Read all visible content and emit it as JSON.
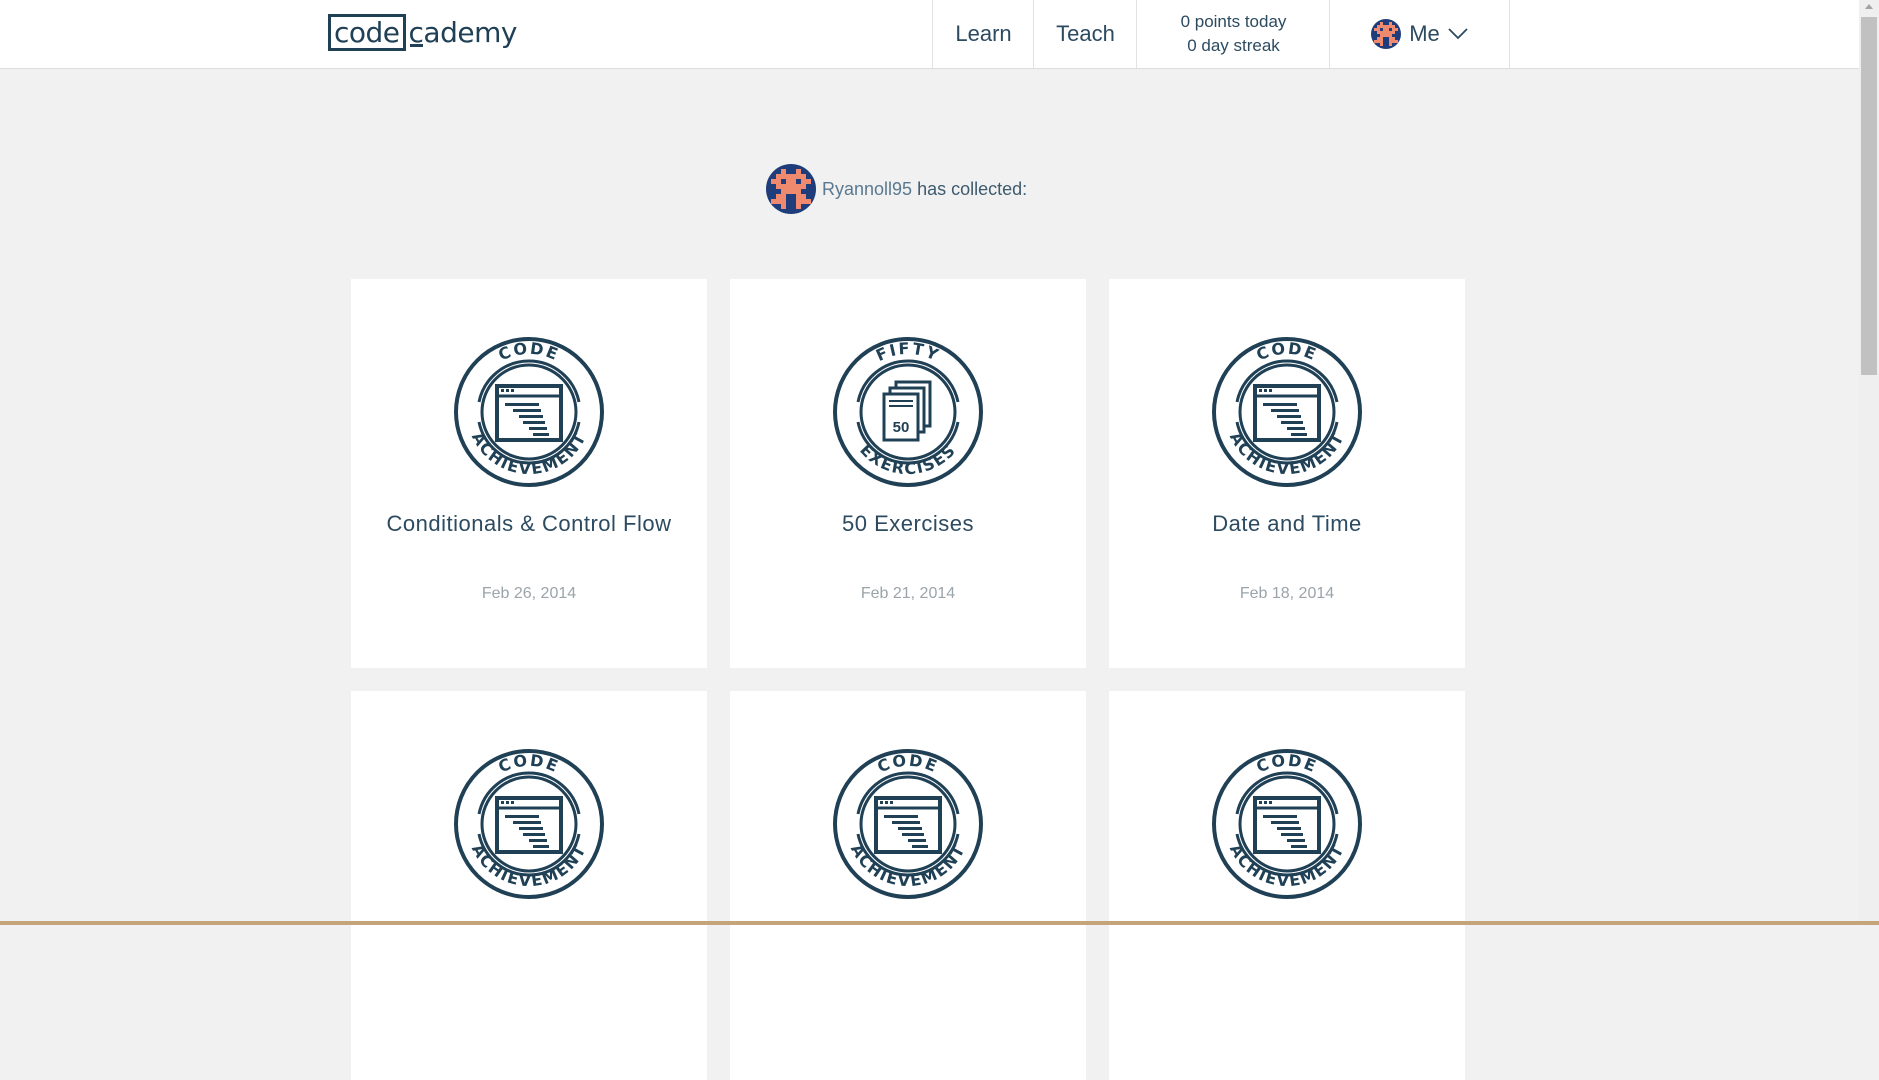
{
  "header": {
    "logo_left": "code",
    "logo_right": "cademy",
    "nav": {
      "learn": "Learn",
      "teach": "Teach"
    },
    "stats": {
      "points": "0 points today",
      "streak": "0 day streak"
    },
    "me_label": "Me"
  },
  "profile": {
    "username": "Ryannoll95",
    "collected_text": "has collected:"
  },
  "badges": [
    {
      "title": "Conditionals & Control Flow",
      "date": "Feb 26, 2014",
      "badge_top": "CODE",
      "badge_bottom": "ACHIEVEMENT",
      "icon": "code-window-icon"
    },
    {
      "title": "50 Exercises",
      "date": "Feb 21, 2014",
      "badge_top": "FIFTY",
      "badge_bottom": "EXERCISES",
      "icon": "stacked-pages-50-icon",
      "icon_number": "50"
    },
    {
      "title": "Date and Time",
      "date": "Feb 18, 2014",
      "badge_top": "CODE",
      "badge_bottom": "ACHIEVEMENT",
      "icon": "code-window-icon"
    },
    {
      "title": "",
      "date": "",
      "badge_top": "CODE",
      "badge_bottom": "ACHIEVEMENT",
      "icon": "code-window-icon"
    },
    {
      "title": "",
      "date": "",
      "badge_top": "CODE",
      "badge_bottom": "ACHIEVEMENT",
      "icon": "code-window-icon"
    },
    {
      "title": "",
      "date": "",
      "badge_top": "CODE",
      "badge_bottom": "ACHIEVEMENT",
      "icon": "code-window-icon"
    }
  ],
  "colors": {
    "brand": "#204056",
    "page_bg": "#f0f1f0",
    "avatar_navy": "#1f3d7a",
    "avatar_salmon": "#f08a6e"
  }
}
